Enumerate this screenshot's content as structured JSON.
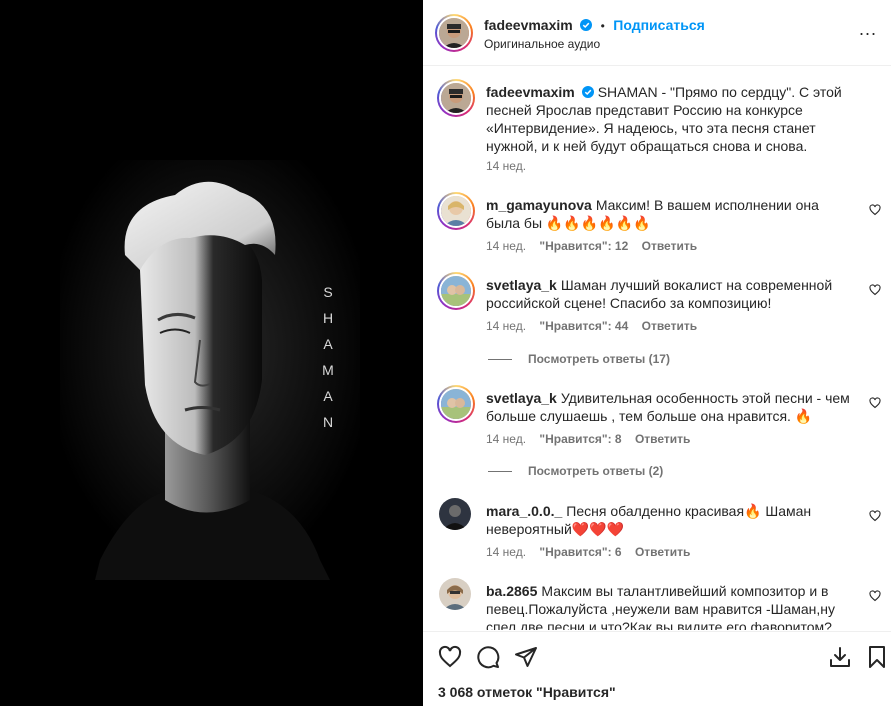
{
  "media": {
    "overlay_text": [
      "S",
      "H",
      "A",
      "M",
      "A",
      "N"
    ]
  },
  "header": {
    "username": "fadeevmaxim",
    "separator": "•",
    "follow_label": "Подписаться",
    "audio_label": "Оригинальное аудио",
    "more_label": "..."
  },
  "caption": {
    "username": "fadeevmaxim",
    "text": "SHAMAN - \"Прямо по сердцу\". С этой песней Ярослав представит Россию на конкурсе «Интервидение». Я надеюсь, что эта песня станет нужной, и к ней будут обращаться снова и снова.",
    "time": "14 нед."
  },
  "comments": [
    {
      "username": "m_gamayunova",
      "text": "Максим! В вашем исполнении она была бы 🔥🔥🔥🔥🔥🔥",
      "time": "14 нед.",
      "likes": "\"Нравится\": 12",
      "reply": "Ответить"
    },
    {
      "username": "svetlaya_k",
      "text": "Шаман лучший вокалист на современной российской сцене! Спасибо за композицию!",
      "time": "14 нед.",
      "likes": "\"Нравится\": 44",
      "reply": "Ответить",
      "view_replies": "Посмотреть ответы (17)"
    },
    {
      "username": "svetlaya_k",
      "text": "Удивительная особенность этой песни - чем больше слушаешь , тем больше она нравится. 🔥",
      "time": "14 нед.",
      "likes": "\"Нравится\": 8",
      "reply": "Ответить",
      "view_replies": "Посмотреть ответы (2)"
    },
    {
      "username": "mara_.0.0._",
      "text": "Песня обалденно красивая🔥 Шаман невероятный❤️❤️❤️",
      "time": "14 нед.",
      "likes": "\"Нравится\": 6",
      "reply": "Ответить"
    },
    {
      "username": "ba.2865",
      "text": "Максим вы талантливейший композитор и в певец.Пожалуйста ,неужели вам нравится -Шаман,ну спел две песни и что?Как вы видите его фаворитом?Тогда я"
    }
  ],
  "footer": {
    "likes_count": "3 068 отметок \"Нравится\""
  },
  "colors": {
    "accent": "#0095f6",
    "text": "#262626",
    "muted": "#737373",
    "verified": "#0095f6"
  }
}
